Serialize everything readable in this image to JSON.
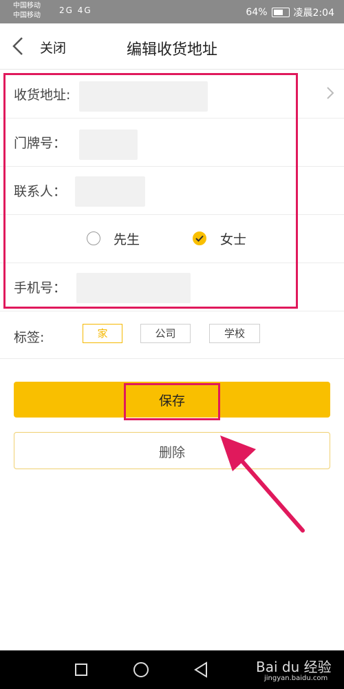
{
  "status_bar": {
    "carrier1": "中国移动",
    "carrier2": "中国移动",
    "signal_icons": "2G 4G",
    "battery": "64%",
    "time": "凌晨2:04"
  },
  "header": {
    "close_label": "关闭",
    "title": "编辑收货地址"
  },
  "form": {
    "address_label": "收货地址:",
    "door_label": "门牌号：",
    "contact_label": "联系人：",
    "gender_options": [
      "先生",
      "女士"
    ],
    "gender_selected": "女士",
    "phone_label": "手机号："
  },
  "tags": {
    "label": "标签:",
    "options": [
      "家",
      "公司",
      "学校"
    ],
    "selected": "家"
  },
  "actions": {
    "save_label": "保存",
    "delete_label": "删除"
  },
  "watermark": {
    "brand": "Bai du 经验",
    "site": "jingyan.baidu.com"
  },
  "colors": {
    "accent": "#f9bf00",
    "highlight": "#e0195c"
  }
}
